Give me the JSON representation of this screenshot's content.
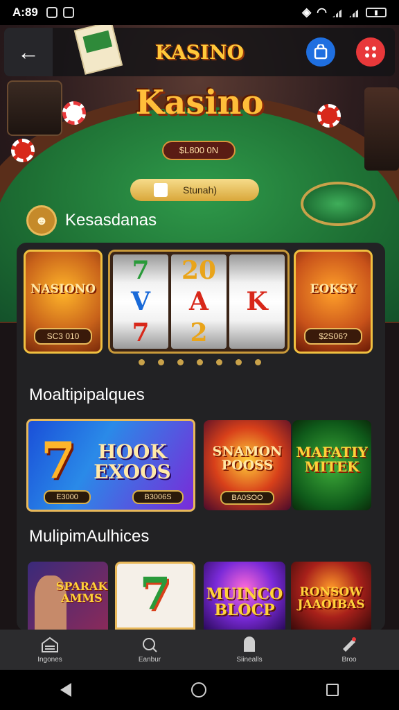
{
  "status_bar": {
    "time": "A:89"
  },
  "app_bar": {
    "title": "KASINO",
    "back_icon": "arrow-left-icon",
    "action_icons": [
      "bag-icon",
      "dice-icon"
    ]
  },
  "hero": {
    "title": "Kasino",
    "pot": "$L800 0N",
    "promo": "Stunah)"
  },
  "section_1": {
    "title": "Kesasdanas"
  },
  "featured": [
    {
      "title": "NASIONO",
      "price": "SC3 010"
    },
    {
      "title": "EOKSY",
      "price": "$2S06? "
    }
  ],
  "reels": [
    [
      "7",
      "Ⅴ",
      "7"
    ],
    [
      "20",
      "A",
      "2"
    ],
    [
      "",
      "K",
      ""
    ]
  ],
  "section_2": {
    "title": "Moaltipipalques"
  },
  "section_2_tiles": [
    {
      "title": "HOOK EXOOS",
      "price_left": "E3000",
      "price_right": "B3006S"
    },
    {
      "title": "SNAMON POOSS",
      "price": "BA0SOO"
    },
    {
      "title": "MAFATIY MITEK",
      "price": ""
    }
  ],
  "section_3": {
    "title": "MulipimAulhices"
  },
  "section_3_tiles": [
    {
      "title": "SPARAK AMMS"
    },
    {
      "title": "7"
    },
    {
      "title": "MUINCO BLOCP"
    },
    {
      "title": "RONSOW JAAOIBAS"
    }
  ],
  "bottom_nav": [
    {
      "label": "Ingones",
      "icon": "home-grid-icon"
    },
    {
      "label": "Eanbur",
      "icon": "search-icon"
    },
    {
      "label": "Siinealls",
      "icon": "door-icon"
    },
    {
      "label": "Broo",
      "icon": "ticket-icon"
    }
  ],
  "colors": {
    "accent_gold": "#ffc93a",
    "felt_green": "#1d6e33",
    "panel": "#222224",
    "blue_button": "#1f6fe0",
    "red_button": "#e8383a"
  }
}
